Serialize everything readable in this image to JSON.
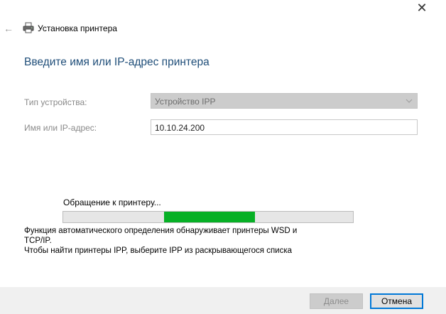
{
  "window": {
    "title": "Установка принтера",
    "close_glyph": "✕",
    "back_glyph": "←"
  },
  "heading": "Введите имя или IP-адрес принтера",
  "form": {
    "device_type_label": "Тип устройства:",
    "device_type_value": "Устройство IPP",
    "address_label": "Имя или IP-адрес:",
    "address_value": "10.10.24.200"
  },
  "progress": {
    "status": "Обращение к принтеру...",
    "indeterminate": true,
    "fill_color": "#06b025"
  },
  "info": {
    "line1": "Функция автоматического определения обнаруживает принтеры WSD и",
    "line2": "TCP/IP.",
    "line3": "Чтобы найти принтеры IPP, выберите IPP из раскрывающегося списка"
  },
  "buttons": {
    "next": "Далее",
    "cancel": "Отмена"
  },
  "colors": {
    "heading": "#1f4e79",
    "accent_border": "#0078d7"
  },
  "icons": [
    "close-icon",
    "back-arrow-icon",
    "printer-icon",
    "chevron-down-icon"
  ]
}
